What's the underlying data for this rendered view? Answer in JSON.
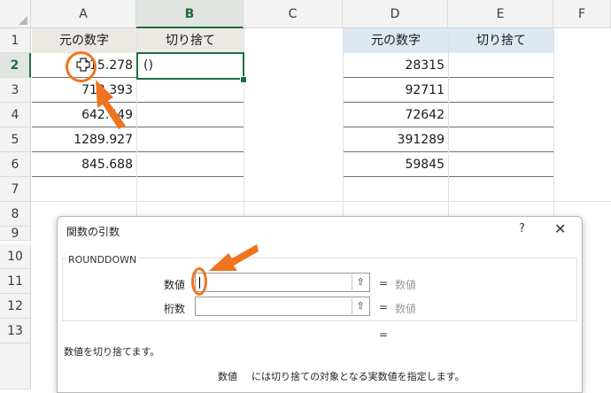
{
  "columns": [
    "A",
    "B",
    "C",
    "D",
    "E",
    "F"
  ],
  "rows": [
    "1",
    "2",
    "3",
    "4",
    "5",
    "6",
    "7",
    "8",
    "9",
    "10",
    "11",
    "12",
    "13"
  ],
  "table_left": {
    "headers": [
      "元の数字",
      "切り捨て"
    ],
    "values": [
      "315.278",
      "713.393",
      "642.449",
      "1289.927",
      "845.688"
    ],
    "b2_value": "()"
  },
  "table_right": {
    "headers": [
      "元の数字",
      "切り捨て"
    ],
    "values": [
      "28315",
      "92711",
      "72642",
      "391289",
      "59845"
    ]
  },
  "dialog": {
    "title": "関数の引数",
    "help": "?",
    "close": "✕",
    "function_name": "ROUNDDOWN",
    "args": [
      {
        "label": "数値",
        "value": "",
        "result": "数値"
      },
      {
        "label": "桁数",
        "value": "",
        "result": "数値"
      }
    ],
    "equals": "=",
    "description": "数値を切り捨てます。",
    "arg_help_name": "数値",
    "arg_help_text": "には切り捨ての対象となる実数値を指定します。",
    "ref_icon": "⇧"
  },
  "colors": {
    "selected": "#1f6e43",
    "highlight": "#f0731f"
  }
}
